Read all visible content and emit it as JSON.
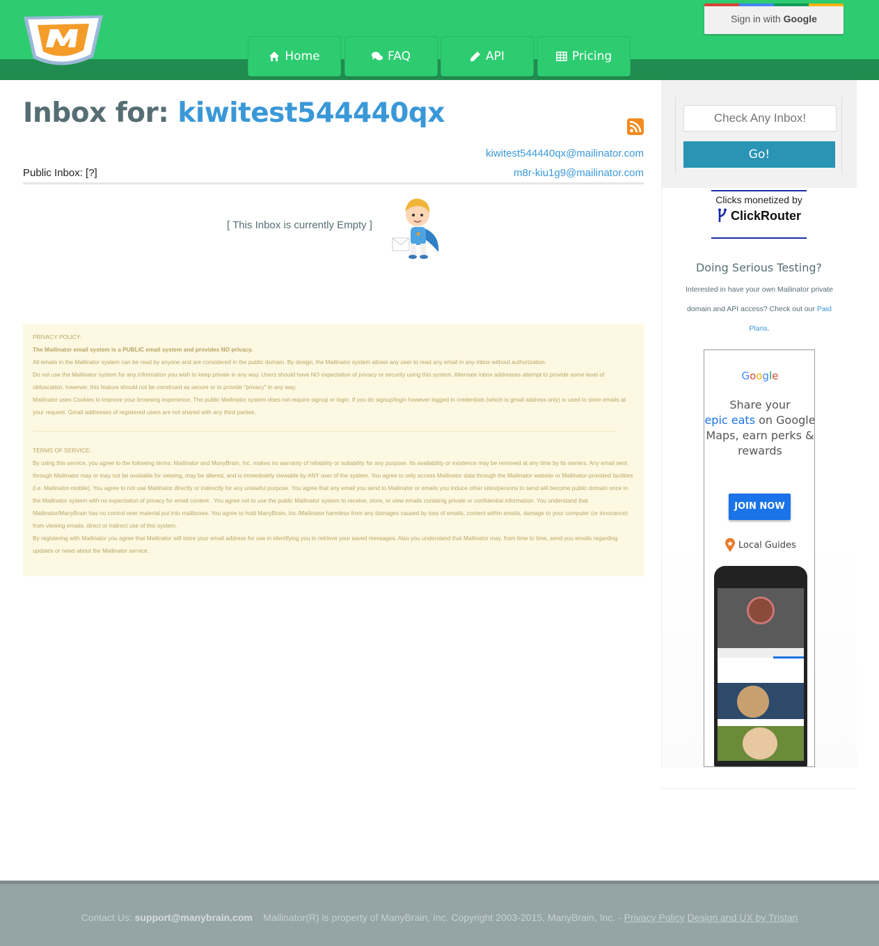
{
  "header": {
    "nav": [
      {
        "label": "Home",
        "icon": "home-icon"
      },
      {
        "label": "FAQ",
        "icon": "comments-icon"
      },
      {
        "label": "API",
        "icon": "pencil-icon"
      },
      {
        "label": "Pricing",
        "icon": "table-icon"
      }
    ],
    "signin": {
      "prefix": "Sign in with",
      "brand": "Google"
    },
    "colors": {
      "bar": "#2ecc71",
      "band": "#218c4f"
    }
  },
  "main": {
    "title_prefix": "Inbox for:",
    "inbox_name": "kiwitest544440qx",
    "email_primary": "kiwitest544440qx@mailinator.com",
    "email_alias": "m8r-kiu1g9@mailinator.com",
    "public_label": "Public Inbox:  [?]",
    "empty_message": "[ This Inbox is currently Empty ]"
  },
  "legal": {
    "privacy_header": "PRIVACY POLICY:",
    "privacy_lines": [
      "The Mailinator email system is a PUBLIC email system and provides NO privacy.",
      "All emails in the Mailinator system can be read by anyone and are considered in the public domain. By design, the Mailinator system allows any user to read any email in any inbox without authorization.",
      "Do not use the Mailinator system for any information you wish to keep private in any way. Users should have NO expectation of privacy or security using this system. Alternate inbox addresses attempt to provide some level of obfuscation, however, this feature should not be construed as secure or to provide \"privacy\" in any way.",
      "Mailinator uses Cookies to improve your browsing experience. The public Mailinator system does not require signup or login. If you do signup/login however logged in credentials (which is gmail address only) is used to store emails at your request. Gmail addresses of registered users are not shared with any third parties."
    ],
    "tos_header": "TERMS OF SERVICE:",
    "tos_lines": [
      "By using this service, you agree to the following terms: Mailinator and ManyBrain, Inc. makes no warranty of reliability or suitability for any purpose. Its availability or existence may be removed at any time by its owners. Any email sent through Mailinator may or may not be available for viewing, may be altered, and is immediately viewable by ANY user of the system. You agree to only access Mailinator data through the Mailinator website or Mailinator-provided facilities (i.e. Mailinator-mobile). You agree to not use Mailinator directly or indirectly for any unlawful purpose. You agree that any email you send to Mailinator or emails you induce other sites/persons to send will become public domain once in the Mailinator system with no expectation of privacy for email content . You agree not to use the public Mailinator system to receive, store, or view emails containig private or confidential information. You understand that Mailinator/ManyBrain has no control over material put into mailboxes. You agree to hold ManyBrain, Inc./Mailinator harmless from any damages caused by loss of emails, content within emails, damage to your computer (or innocence) from viewing emails, direct or indirect use of this system.",
      "By registering with Mailinator you agree that Mailinator will store your email address for use in identifying you to retrieve your saved messages. Also you understand that Mailinator may, from time to time, send you emails regarding updates or news about the Mailinator service."
    ]
  },
  "sidebar": {
    "check_placeholder": "Check Any Inbox!",
    "go_label": "Go!",
    "clickrouter_line1": "Clicks monetized by",
    "clickrouter_brand": "ClickRouter",
    "serious_title": "Doing Serious Testing?",
    "serious_text": "Interested in have your own Mailinator private domain and API access? Check out our",
    "paid_link": "Paid Plans",
    "serious_end": "."
  },
  "ad": {
    "brand": "Google",
    "headline_1": "Share your",
    "headline_hl": "epic eats",
    "headline_2": "on Google Maps, earn perks & rewards",
    "cta": "JOIN NOW",
    "program": "Local Guides"
  },
  "footer": {
    "contact_label": "Contact Us:",
    "contact_email": "support@manybrain.com",
    "copyright": "Mailinator(R) is property of ManyBrain, Inc. Copyright 2003-2015, ManyBrain, Inc. -",
    "privacy_link": "Privacy Policy",
    "design_link": "Design and UX by Tristan"
  }
}
